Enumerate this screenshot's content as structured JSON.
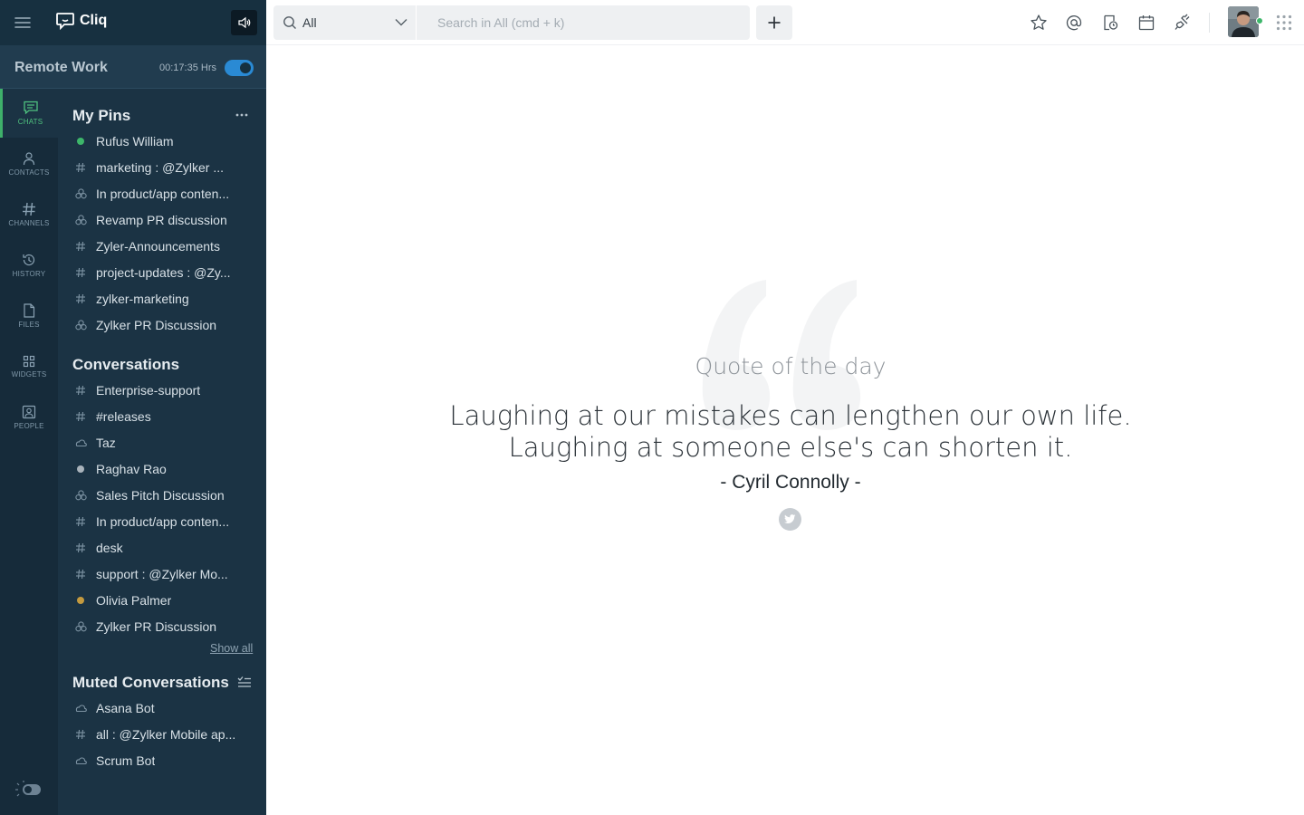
{
  "app": {
    "name": "Cliq"
  },
  "status": {
    "name": "Remote Work",
    "timer": "00:17:35 Hrs",
    "toggle_on": true
  },
  "rail": [
    {
      "label": "CHATS",
      "icon": "chat-icon",
      "active": true
    },
    {
      "label": "CONTACTS",
      "icon": "contacts-icon",
      "active": false
    },
    {
      "label": "CHANNELS",
      "icon": "channels-icon",
      "active": false
    },
    {
      "label": "HISTORY",
      "icon": "history-icon",
      "active": false
    },
    {
      "label": "FILES",
      "icon": "files-icon",
      "active": false
    },
    {
      "label": "WIDGETS",
      "icon": "widgets-icon",
      "active": false
    },
    {
      "label": "PEOPLE",
      "icon": "people-icon",
      "active": false
    }
  ],
  "pins": {
    "title": "My Pins",
    "items": [
      {
        "label": "Rufus William",
        "icon": "online-dot"
      },
      {
        "label": "marketing : @Zylker ...",
        "icon": "hash-icon"
      },
      {
        "label": "In product/app conten...",
        "icon": "group-icon"
      },
      {
        "label": "Revamp PR discussion",
        "icon": "group-icon"
      },
      {
        "label": "Zyler-Announcements",
        "icon": "hash-icon"
      },
      {
        "label": "project-updates : @Zy...",
        "icon": "hash-icon"
      },
      {
        "label": "zylker-marketing",
        "icon": "hash-icon"
      },
      {
        "label": "Zylker PR Discussion",
        "icon": "group-icon"
      }
    ]
  },
  "conversations": {
    "title": "Conversations",
    "show_all": "Show all",
    "items": [
      {
        "label": "Enterprise-support",
        "icon": "hash-icon"
      },
      {
        "label": "#releases",
        "icon": "hash-icon"
      },
      {
        "label": "Taz",
        "icon": "bot-icon"
      },
      {
        "label": "Raghav Rao",
        "icon": "offline-dot"
      },
      {
        "label": "Sales Pitch Discussion",
        "icon": "group-icon"
      },
      {
        "label": "In product/app conten...",
        "icon": "hash-icon"
      },
      {
        "label": "desk",
        "icon": "hash-icon"
      },
      {
        "label": "support : @Zylker Mo...",
        "icon": "hash-icon"
      },
      {
        "label": "Olivia Palmer",
        "icon": "away-dot"
      },
      {
        "label": "Zylker PR Discussion",
        "icon": "group-icon"
      }
    ]
  },
  "muted": {
    "title": "Muted Conversations",
    "items": [
      {
        "label": "Asana Bot",
        "icon": "bot-icon"
      },
      {
        "label": "all : @Zylker Mobile ap...",
        "icon": "hash-icon"
      },
      {
        "label": "Scrum Bot",
        "icon": "bot-icon"
      }
    ]
  },
  "search": {
    "scope": "All",
    "placeholder": "Search in All (cmd + k)"
  },
  "colors": {
    "sidebar": "#1b3344",
    "rail": "#162b3a",
    "accent_green": "#3eb06a",
    "toggle_blue": "#2a8ad4",
    "online": "#3db66a",
    "away": "#c49a3f",
    "offline": "#a9b3bb"
  },
  "quote": {
    "heading": "Quote of the day",
    "line1": "Laughing at our mistakes can lengthen our own life.",
    "line2": "Laughing at someone else's can shorten it.",
    "author": "- Cyril Connolly -"
  }
}
